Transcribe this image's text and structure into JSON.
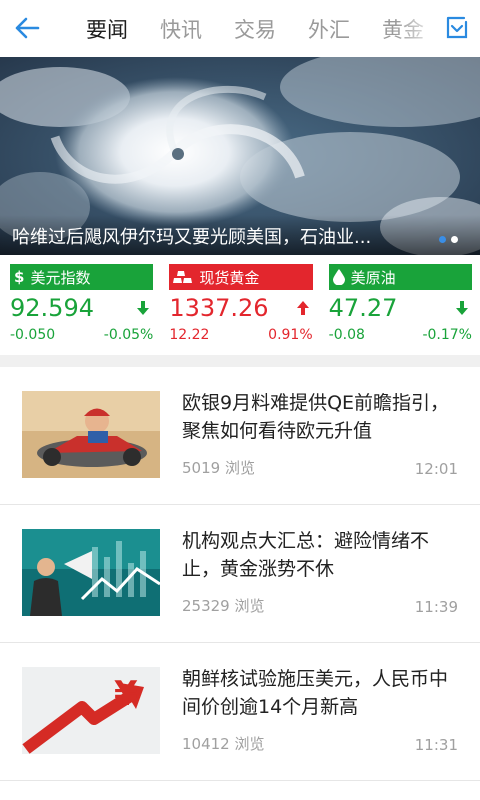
{
  "nav": {
    "back_icon": "back-arrow-icon",
    "tabs": [
      {
        "label": "要闻",
        "active": true
      },
      {
        "label": "快讯",
        "active": false
      },
      {
        "label": "交易",
        "active": false
      },
      {
        "label": "外汇",
        "active": false
      },
      {
        "label": "黄金",
        "active": false
      }
    ],
    "manage_icon": "tab-manage-icon"
  },
  "banner": {
    "caption": "哈维过后飓风伊尔玛又要光顾美国，石油业...",
    "slides": 2,
    "active_slide": 0
  },
  "quotes": [
    {
      "name": "美元指数",
      "icon": "dollar-icon",
      "price": "92.594",
      "change": "-0.050",
      "percent": "-0.05%",
      "direction": "down",
      "header_color": "#19a33a"
    },
    {
      "name": "现货黄金",
      "icon": "gold-bars-icon",
      "price": "1337.26",
      "change": "12.22",
      "percent": "0.91%",
      "direction": "up",
      "header_color": "#e3262d"
    },
    {
      "name": "美原油",
      "icon": "oil-drop-icon",
      "price": "47.27",
      "change": "-0.08",
      "percent": "-0.17%",
      "direction": "down",
      "header_color": "#19a33a"
    }
  ],
  "news": [
    {
      "title": "欧银9月料难提供QE前瞻指引，聚焦如何看待欧元升值",
      "views": "5019 浏览",
      "time": "12:01",
      "thumb": "kart-racer-thumbnail"
    },
    {
      "title": "机构观点大汇总：避险情绪不止，黄金涨势不休",
      "views": "25329 浏览",
      "time": "11:39",
      "thumb": "megaphone-chart-thumbnail"
    },
    {
      "title": "朝鲜核试验施压美元，人民币中间价创逾14个月新高",
      "views": "10412 浏览",
      "time": "11:31",
      "thumb": "yuan-arrow-thumbnail"
    }
  ],
  "colors": {
    "up": "#e3262d",
    "down": "#19a33a",
    "accent": "#3a8ee6"
  }
}
